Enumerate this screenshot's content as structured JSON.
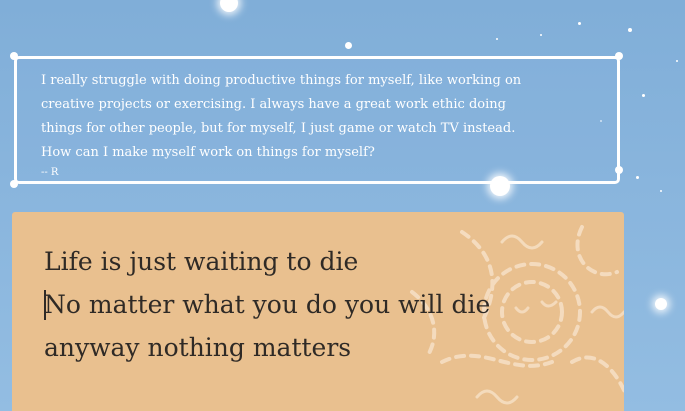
{
  "letter": {
    "body": "I really struggle with doing productive things for myself, like working on\ncreative projects or exercising. I always have a great work ethic doing\nthings for other people, but for myself, I just game or watch TV instead.\nHow can I make myself work on things for myself?",
    "signature": "-- R"
  },
  "reply": {
    "text": "Life is just waiting to die\nNo matter what you do you will die\nanyway nothing matters"
  },
  "colors": {
    "sky": "#89b5dd",
    "paper": "#e9c08f",
    "reply_text": "#2f2a26",
    "letter_border": "#ffffff"
  }
}
